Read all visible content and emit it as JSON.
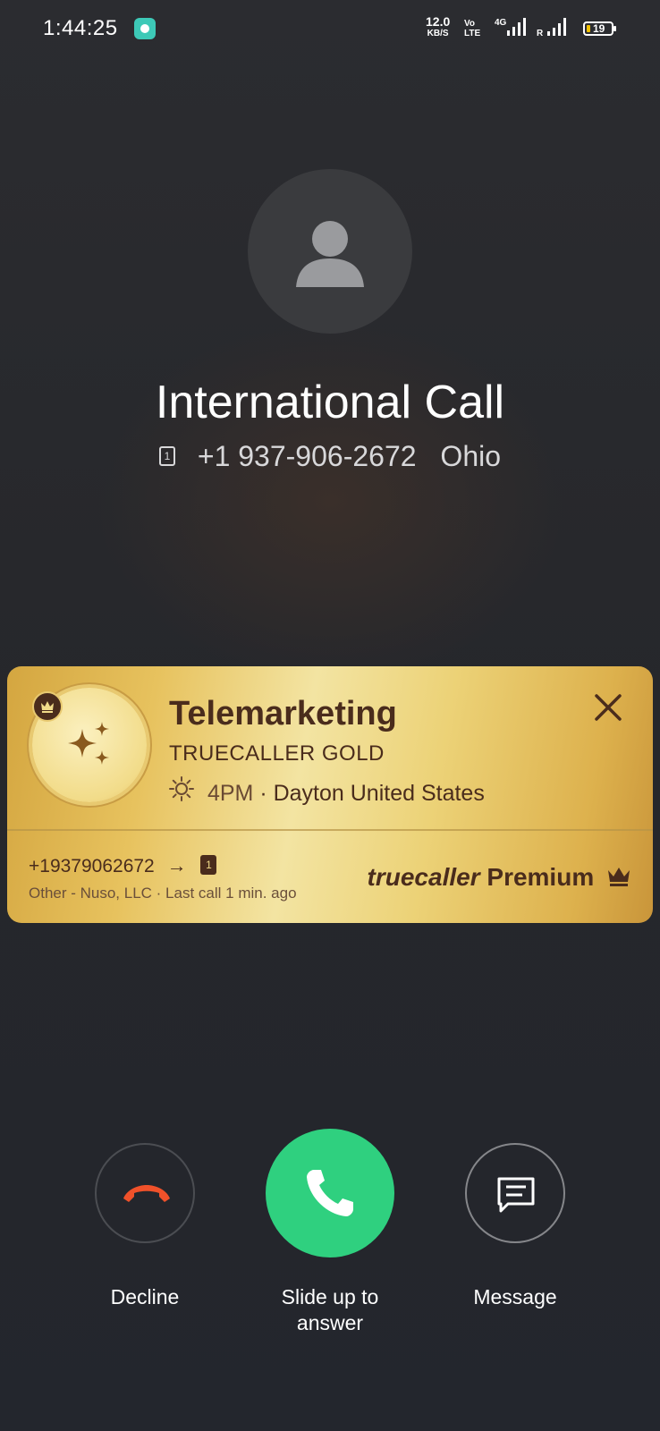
{
  "status_bar": {
    "time": "1:44:25",
    "net_speed_value": "12.0",
    "net_speed_unit": "KB/S",
    "volte_top": "Vo",
    "volte_bottom": "LTE",
    "network_type": "4G",
    "roaming": "R",
    "battery_level": "19",
    "battery_fraction": 0.19
  },
  "call": {
    "title": "International Call",
    "sim_slot": "1",
    "number": "+1 937-906-2672",
    "location": "Ohio"
  },
  "truecaller_card": {
    "title": "Telemarketing",
    "tier": "TRUECALLER GOLD",
    "local_time": "4PM",
    "separator": "·",
    "place": "Dayton United States",
    "number": "+19379062672",
    "arrow": "→",
    "sim_slot": "1",
    "carrier_info": "Other - Nuso, LLC · Last call 1 min. ago",
    "brand_truecaller": "truecaller",
    "brand_premium": "Premium",
    "colors": {
      "brown": "#4a2c1c",
      "gold": "#e7c25e"
    }
  },
  "actions": {
    "decline_label": "Decline",
    "answer_label_line1": "Slide up to",
    "answer_label_line2": "answer",
    "message_label": "Message",
    "colors": {
      "decline": "#f0512a",
      "answer": "#2fd07f"
    }
  }
}
